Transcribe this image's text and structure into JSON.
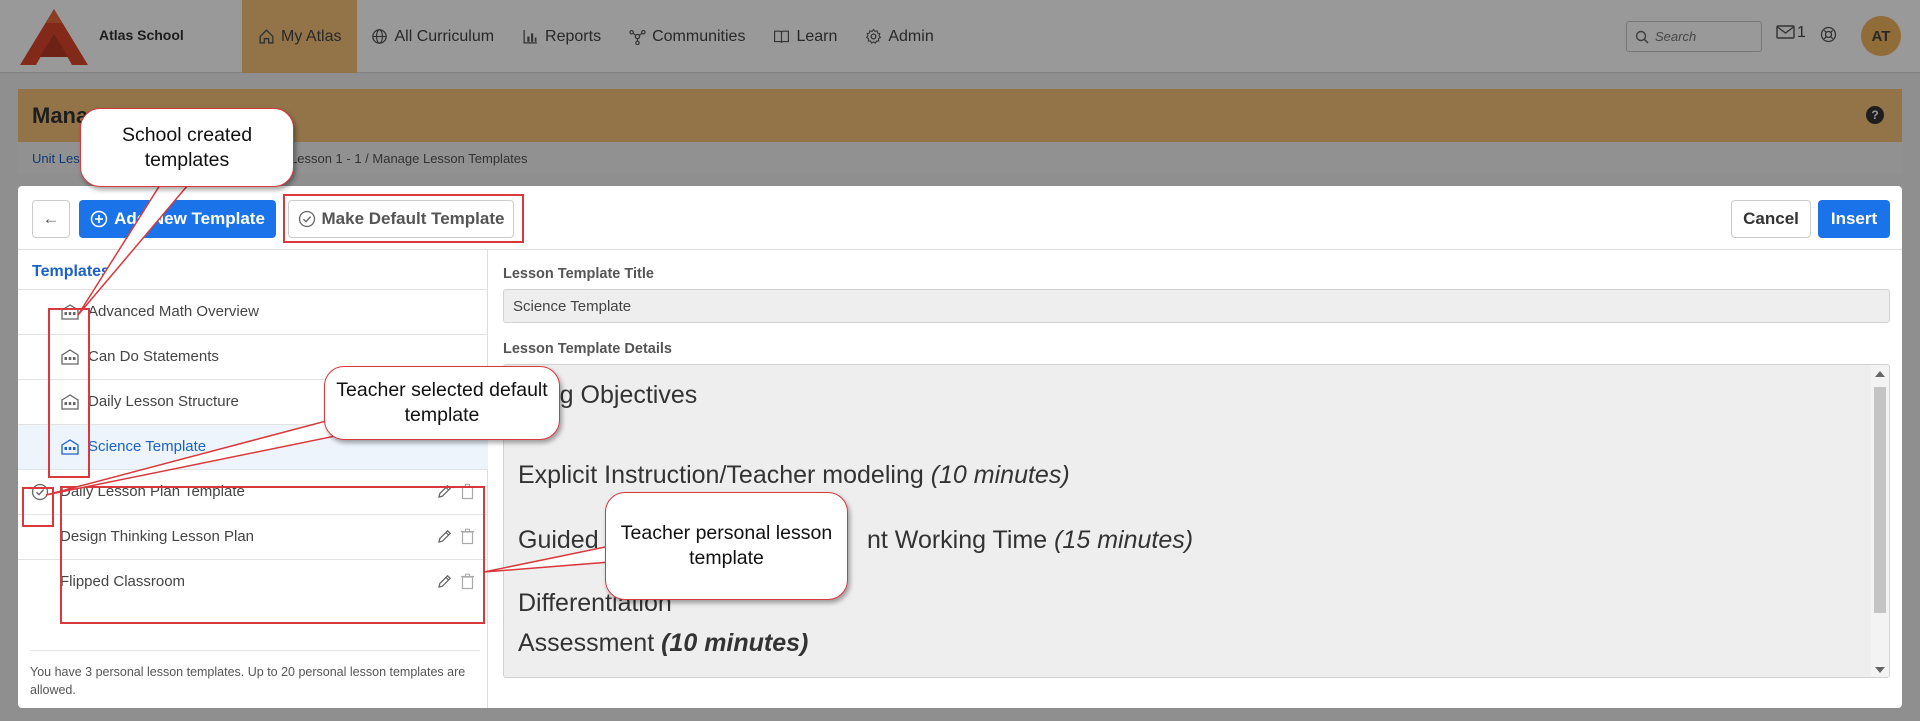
{
  "app": {
    "school_name": "Atlas School",
    "brand_color": "#d9452b",
    "accent_color": "#f5c27a",
    "primary_button_color": "#1a73e8"
  },
  "nav": {
    "items": [
      {
        "label": "My Atlas",
        "icon": "home-icon",
        "active": true
      },
      {
        "label": "All Curriculum",
        "icon": "globe-icon",
        "active": false
      },
      {
        "label": "Reports",
        "icon": "bar-chart-icon",
        "active": false
      },
      {
        "label": "Communities",
        "icon": "network-icon",
        "active": false
      },
      {
        "label": "Learn",
        "icon": "book-icon",
        "active": false
      },
      {
        "label": "Admin",
        "icon": "gear-icon",
        "active": false
      }
    ],
    "search_placeholder": "Search",
    "mail_count": "1",
    "user_initials": "AT"
  },
  "page": {
    "title": "Mana",
    "help": "?",
    "breadcrumb_start": "Unit Les",
    "breadcrumb_rest": "Lesson 1 - 1  /  Manage Lesson Templates"
  },
  "toolbar": {
    "back_arrow": "←",
    "add_label": "Add New Template",
    "default_label": "Make Default Template",
    "cancel_label": "Cancel",
    "insert_label": "Insert"
  },
  "templates": {
    "heading": "Templates",
    "school": [
      "Advanced Math Overview",
      "Can Do Statements",
      "Daily Lesson Structure",
      "Science Template"
    ],
    "personal": [
      "Daily Lesson Plan Template",
      "Design Thinking Lesson Plan",
      "Flipped Classroom"
    ],
    "footer": "You have 3 personal lesson templates. Up to 20 personal lesson templates are allowed."
  },
  "detail": {
    "title_label": "Lesson Template Title",
    "title_value": "Science Template",
    "details_label": "Lesson Template Details",
    "lines": {
      "l1": "rning Objectives",
      "l2_text": "Explicit Instruction/Teacher modeling ",
      "l2_time": "(10 minutes)",
      "l3a": "Guided",
      "l3b": "nt Working Time ",
      "l3_time": "(15 minutes)",
      "l4": "Differentiation",
      "l5_text": "Assessment ",
      "l5_time": "(10 minutes)"
    }
  },
  "annotations": {
    "school": "School created templates",
    "teacher_default": "Teacher selected default template",
    "teacher_personal": "Teacher personal lesson template"
  }
}
